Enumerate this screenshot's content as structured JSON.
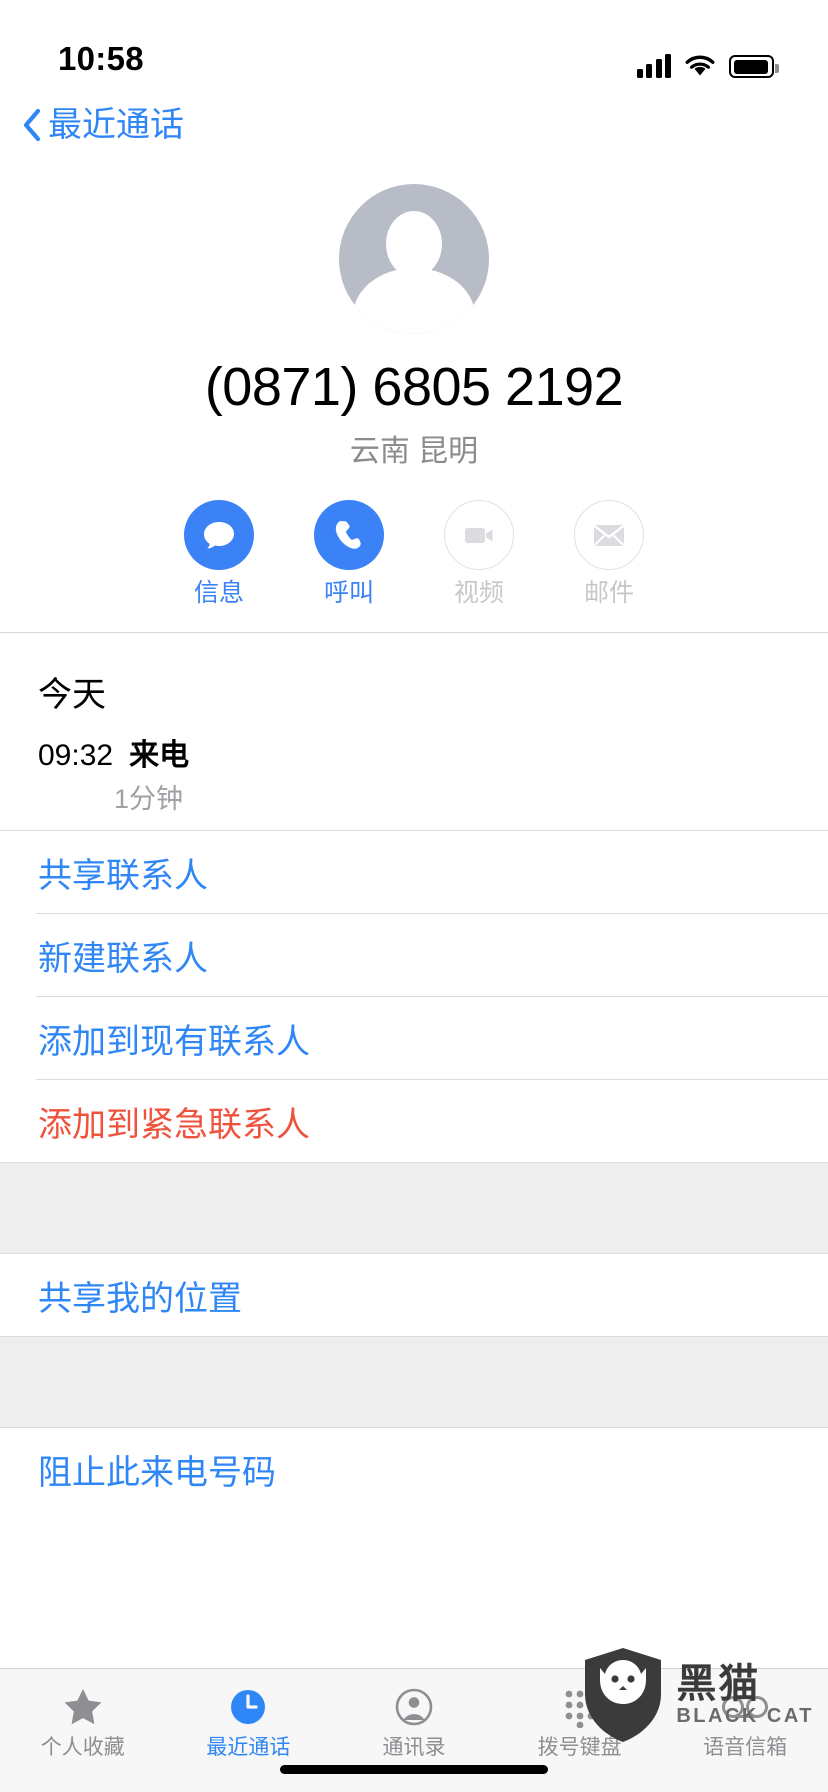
{
  "status_bar": {
    "time": "10:58",
    "icons": [
      "cellular-signal-icon",
      "wifi-icon",
      "battery-icon"
    ]
  },
  "nav": {
    "back_label": "最近通话",
    "back_icon": "chevron-left-icon"
  },
  "contact": {
    "avatar_icon": "person-placeholder-icon",
    "phone_number": "(0871) 6805 2192",
    "location": "云南 昆明"
  },
  "quick_actions": [
    {
      "label": "信息",
      "icon": "message-bubble-icon",
      "enabled": true
    },
    {
      "label": "呼叫",
      "icon": "phone-handset-icon",
      "enabled": true
    },
    {
      "label": "视频",
      "icon": "video-camera-icon",
      "enabled": false
    },
    {
      "label": "邮件",
      "icon": "envelope-icon",
      "enabled": false
    }
  ],
  "call_log": {
    "date_header": "今天",
    "entries": [
      {
        "time": "09:32",
        "type": "来电",
        "duration": "1分钟"
      }
    ]
  },
  "action_rows": [
    {
      "label": "共享联系人",
      "style": "link"
    },
    {
      "label": "新建联系人",
      "style": "link"
    },
    {
      "label": "添加到现有联系人",
      "style": "link"
    },
    {
      "label": "添加到紧急联系人",
      "style": "danger"
    }
  ],
  "location_rows": [
    {
      "label": "共享我的位置",
      "style": "link"
    }
  ],
  "block_rows": [
    {
      "label": "阻止此来电号码",
      "style": "link"
    }
  ],
  "tab_bar": [
    {
      "label": "个人收藏",
      "icon": "star-icon",
      "active": false
    },
    {
      "label": "最近通话",
      "icon": "clock-icon",
      "active": true
    },
    {
      "label": "通讯录",
      "icon": "person-circle-icon",
      "active": false
    },
    {
      "label": "拨号键盘",
      "icon": "keypad-icon",
      "active": false
    },
    {
      "label": "语音信箱",
      "icon": "voicemail-icon",
      "active": false
    }
  ],
  "watermark": {
    "icon": "black-cat-shield-icon",
    "title_cn": "黑猫",
    "title_en": "BLACK CAT"
  },
  "colors": {
    "accent_blue": "#2f86f6",
    "icon_blue": "#3b82f6",
    "danger_red": "#f0533d",
    "disabled_gray": "#c8c8cc",
    "secondary_text": "#8b8b90",
    "group_bg": "#eeeeef",
    "tabbar_bg": "#f7f7f8"
  }
}
